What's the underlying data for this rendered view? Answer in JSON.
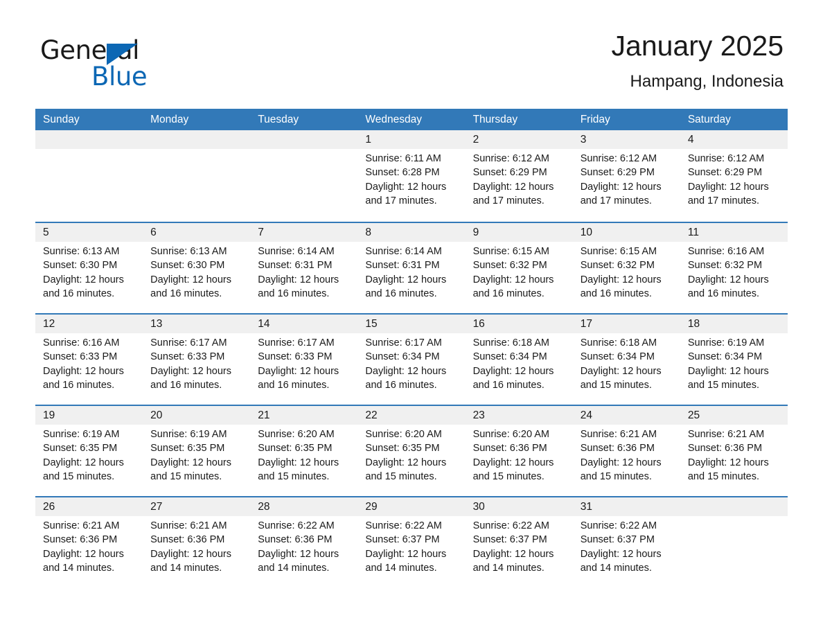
{
  "brand": {
    "logo_text_primary": "General",
    "logo_text_secondary": "Blue",
    "logo_triangle_icon": "triangle-icon",
    "accent_color": "#0c67b4"
  },
  "header": {
    "title": "January 2025",
    "subtitle": "Hampang, Indonesia"
  },
  "calendar": {
    "header_bg_color": "#3279b8",
    "daynum_band_color": "#f0f0f0",
    "weekdays": [
      "Sunday",
      "Monday",
      "Tuesday",
      "Wednesday",
      "Thursday",
      "Friday",
      "Saturday"
    ],
    "weeks": [
      [
        {
          "day": "",
          "info": ""
        },
        {
          "day": "",
          "info": ""
        },
        {
          "day": "",
          "info": ""
        },
        {
          "day": "1",
          "info": "Sunrise: 6:11 AM\nSunset: 6:28 PM\nDaylight: 12 hours\nand 17 minutes."
        },
        {
          "day": "2",
          "info": "Sunrise: 6:12 AM\nSunset: 6:29 PM\nDaylight: 12 hours\nand 17 minutes."
        },
        {
          "day": "3",
          "info": "Sunrise: 6:12 AM\nSunset: 6:29 PM\nDaylight: 12 hours\nand 17 minutes."
        },
        {
          "day": "4",
          "info": "Sunrise: 6:12 AM\nSunset: 6:29 PM\nDaylight: 12 hours\nand 17 minutes."
        }
      ],
      [
        {
          "day": "5",
          "info": "Sunrise: 6:13 AM\nSunset: 6:30 PM\nDaylight: 12 hours\nand 16 minutes."
        },
        {
          "day": "6",
          "info": "Sunrise: 6:13 AM\nSunset: 6:30 PM\nDaylight: 12 hours\nand 16 minutes."
        },
        {
          "day": "7",
          "info": "Sunrise: 6:14 AM\nSunset: 6:31 PM\nDaylight: 12 hours\nand 16 minutes."
        },
        {
          "day": "8",
          "info": "Sunrise: 6:14 AM\nSunset: 6:31 PM\nDaylight: 12 hours\nand 16 minutes."
        },
        {
          "day": "9",
          "info": "Sunrise: 6:15 AM\nSunset: 6:32 PM\nDaylight: 12 hours\nand 16 minutes."
        },
        {
          "day": "10",
          "info": "Sunrise: 6:15 AM\nSunset: 6:32 PM\nDaylight: 12 hours\nand 16 minutes."
        },
        {
          "day": "11",
          "info": "Sunrise: 6:16 AM\nSunset: 6:32 PM\nDaylight: 12 hours\nand 16 minutes."
        }
      ],
      [
        {
          "day": "12",
          "info": "Sunrise: 6:16 AM\nSunset: 6:33 PM\nDaylight: 12 hours\nand 16 minutes."
        },
        {
          "day": "13",
          "info": "Sunrise: 6:17 AM\nSunset: 6:33 PM\nDaylight: 12 hours\nand 16 minutes."
        },
        {
          "day": "14",
          "info": "Sunrise: 6:17 AM\nSunset: 6:33 PM\nDaylight: 12 hours\nand 16 minutes."
        },
        {
          "day": "15",
          "info": "Sunrise: 6:17 AM\nSunset: 6:34 PM\nDaylight: 12 hours\nand 16 minutes."
        },
        {
          "day": "16",
          "info": "Sunrise: 6:18 AM\nSunset: 6:34 PM\nDaylight: 12 hours\nand 16 minutes."
        },
        {
          "day": "17",
          "info": "Sunrise: 6:18 AM\nSunset: 6:34 PM\nDaylight: 12 hours\nand 15 minutes."
        },
        {
          "day": "18",
          "info": "Sunrise: 6:19 AM\nSunset: 6:34 PM\nDaylight: 12 hours\nand 15 minutes."
        }
      ],
      [
        {
          "day": "19",
          "info": "Sunrise: 6:19 AM\nSunset: 6:35 PM\nDaylight: 12 hours\nand 15 minutes."
        },
        {
          "day": "20",
          "info": "Sunrise: 6:19 AM\nSunset: 6:35 PM\nDaylight: 12 hours\nand 15 minutes."
        },
        {
          "day": "21",
          "info": "Sunrise: 6:20 AM\nSunset: 6:35 PM\nDaylight: 12 hours\nand 15 minutes."
        },
        {
          "day": "22",
          "info": "Sunrise: 6:20 AM\nSunset: 6:35 PM\nDaylight: 12 hours\nand 15 minutes."
        },
        {
          "day": "23",
          "info": "Sunrise: 6:20 AM\nSunset: 6:36 PM\nDaylight: 12 hours\nand 15 minutes."
        },
        {
          "day": "24",
          "info": "Sunrise: 6:21 AM\nSunset: 6:36 PM\nDaylight: 12 hours\nand 15 minutes."
        },
        {
          "day": "25",
          "info": "Sunrise: 6:21 AM\nSunset: 6:36 PM\nDaylight: 12 hours\nand 15 minutes."
        }
      ],
      [
        {
          "day": "26",
          "info": "Sunrise: 6:21 AM\nSunset: 6:36 PM\nDaylight: 12 hours\nand 14 minutes."
        },
        {
          "day": "27",
          "info": "Sunrise: 6:21 AM\nSunset: 6:36 PM\nDaylight: 12 hours\nand 14 minutes."
        },
        {
          "day": "28",
          "info": "Sunrise: 6:22 AM\nSunset: 6:36 PM\nDaylight: 12 hours\nand 14 minutes."
        },
        {
          "day": "29",
          "info": "Sunrise: 6:22 AM\nSunset: 6:37 PM\nDaylight: 12 hours\nand 14 minutes."
        },
        {
          "day": "30",
          "info": "Sunrise: 6:22 AM\nSunset: 6:37 PM\nDaylight: 12 hours\nand 14 minutes."
        },
        {
          "day": "31",
          "info": "Sunrise: 6:22 AM\nSunset: 6:37 PM\nDaylight: 12 hours\nand 14 minutes."
        },
        {
          "day": "",
          "info": ""
        }
      ]
    ]
  }
}
